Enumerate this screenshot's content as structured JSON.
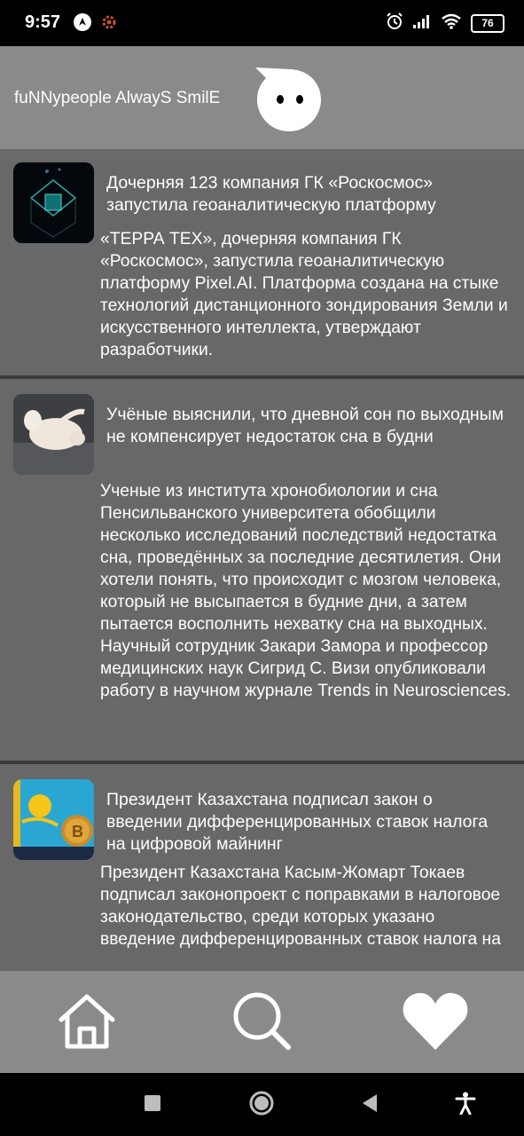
{
  "status_bar": {
    "time": "9:57",
    "battery": "76"
  },
  "header": {
    "title": "fuNNypeople AlwayS SmilE"
  },
  "news": [
    {
      "title": "Дочерняя 123 компания ГК «Роскосмос» запустила геоаналитическую платформу",
      "body": "«ТЕРРА ТЕХ», дочерняя компания ГК «Роскосмос», запустила геоаналитическую платформу Pixel.AI. Платформа создана на стыке технологий дистанционного зондирования Земли и искусственного интеллекта, утверждают разработчики."
    },
    {
      "title": "Учёные выяснили, что дневной сон по выходным не компенсирует недостаток сна в будни",
      "body": "Ученые из института хронобиологии и сна Пенсильванского университета обобщили несколько исследований последствий недостатка сна, проведённых за последние десятилетия. Они хотели понять, что происходит с мозгом человека, который не высыпается в будние дни, а затем пытается восполнить нехватку сна на выходных. Научный сотрудник Закари Замора и профессор медицинских наук Сигрид С. Визи опубликовали работу в научном журнале Trends in Neurosciences."
    },
    {
      "title": "Президент Казахстана подписал закон о введении дифференцированных ставок налога на цифровой майнинг",
      "body": "Президент Казахстана Касым-Жомарт Токаев подписал законопроект с поправками в налоговое законодательство, среди которых указано введение дифференцированных ставок налога на"
    }
  ],
  "icons": {
    "nav_home": "home-icon",
    "nav_search": "search-icon",
    "nav_favorites": "heart-icon"
  },
  "colors": {
    "header_bg": "#8a8a8a",
    "card_bg": "#686868",
    "separator": "#3a3a3a"
  }
}
